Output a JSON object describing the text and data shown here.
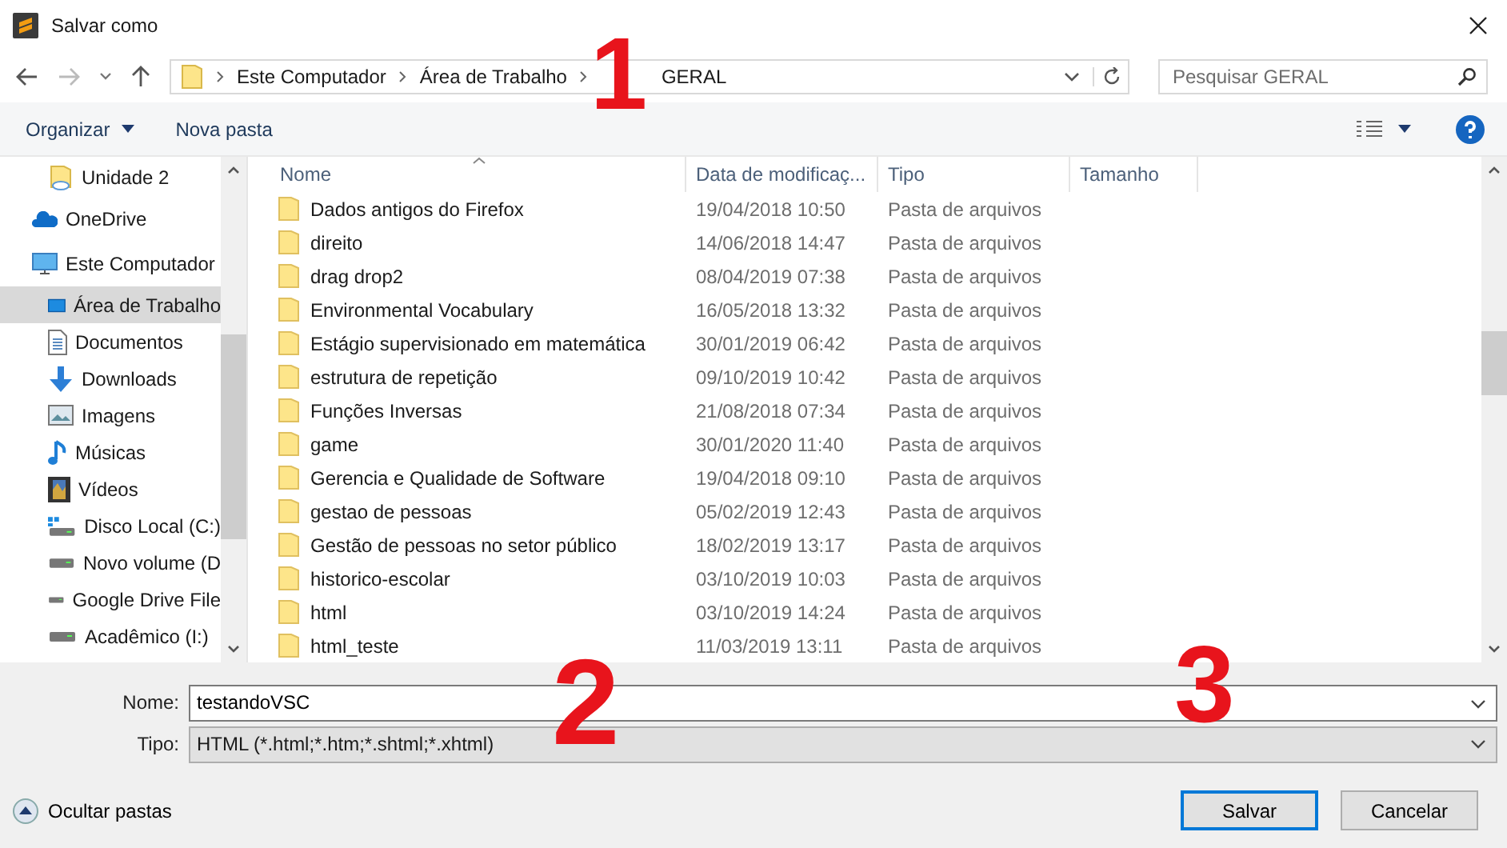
{
  "window": {
    "title": "Salvar como"
  },
  "address_bar": {
    "crumbs": [
      "Este Computador",
      "Área de Trabalho",
      "GERAL"
    ]
  },
  "search": {
    "placeholder": "Pesquisar GERAL"
  },
  "toolbar": {
    "organize": "Organizar",
    "new_folder": "Nova pasta"
  },
  "sidebar": {
    "items": [
      {
        "children": [
          {
            "label": "Unidade 2",
            "kind": "cloud-folder",
            "selected": false
          }
        ]
      },
      {
        "label": "OneDrive",
        "kind": "cloud",
        "selected": false
      },
      {
        "label": "Este Computador",
        "kind": "computer",
        "selected": false,
        "children": [
          {
            "label": "Área de Trabalho",
            "kind": "desktop",
            "selected": true
          },
          {
            "label": "Documentos",
            "kind": "document",
            "selected": false
          },
          {
            "label": "Downloads",
            "kind": "download",
            "selected": false
          },
          {
            "label": "Imagens",
            "kind": "image",
            "selected": false
          },
          {
            "label": "Músicas",
            "kind": "music",
            "selected": false
          },
          {
            "label": "Vídeos",
            "kind": "video",
            "selected": false
          },
          {
            "label": "Disco Local (C:)",
            "kind": "system-drive",
            "selected": false
          },
          {
            "label": "Novo volume (D",
            "kind": "drive",
            "selected": false
          },
          {
            "label": "Google Drive File",
            "kind": "drive",
            "selected": false
          },
          {
            "label": "Acadêmico (I:)",
            "kind": "drive",
            "selected": false
          }
        ]
      }
    ]
  },
  "table": {
    "columns": [
      "Nome",
      "Data de modificaç...",
      "Tipo",
      "Tamanho"
    ],
    "rows": [
      {
        "name": "Dados antigos do Firefox",
        "date": "19/04/2018 10:50",
        "type": "Pasta de arquivos"
      },
      {
        "name": "direito",
        "date": "14/06/2018 14:47",
        "type": "Pasta de arquivos"
      },
      {
        "name": "drag drop2",
        "date": "08/04/2019 07:38",
        "type": "Pasta de arquivos"
      },
      {
        "name": "Environmental Vocabulary",
        "date": "16/05/2018 13:32",
        "type": "Pasta de arquivos"
      },
      {
        "name": "Estágio supervisionado em matemática",
        "date": "30/01/2019 06:42",
        "type": "Pasta de arquivos"
      },
      {
        "name": "estrutura de repetição",
        "date": "09/10/2019 10:42",
        "type": "Pasta de arquivos"
      },
      {
        "name": "Funções Inversas",
        "date": "21/08/2018 07:34",
        "type": "Pasta de arquivos"
      },
      {
        "name": "game",
        "date": "30/01/2020 11:40",
        "type": "Pasta de arquivos"
      },
      {
        "name": "Gerencia e Qualidade de Software",
        "date": "19/04/2018 09:10",
        "type": "Pasta de arquivos"
      },
      {
        "name": "gestao de pessoas",
        "date": "05/02/2019 12:43",
        "type": "Pasta de arquivos"
      },
      {
        "name": "Gestão de pessoas no setor público",
        "date": "18/02/2019 13:17",
        "type": "Pasta de arquivos"
      },
      {
        "name": "historico-escolar",
        "date": "03/10/2019 10:03",
        "type": "Pasta de arquivos"
      },
      {
        "name": "html",
        "date": "03/10/2019 14:24",
        "type": "Pasta de arquivos"
      },
      {
        "name": "html_teste",
        "date": "11/03/2019 13:11",
        "type": "Pasta de arquivos"
      }
    ]
  },
  "form": {
    "name_label": "Nome:",
    "name_value": "testandoVSC",
    "type_label": "Tipo:",
    "type_value": "HTML (*.html;*.htm;*.shtml;*.xhtml)"
  },
  "footer": {
    "hide_folders": "Ocultar pastas",
    "buttons": [
      "Salvar",
      "Cancelar"
    ]
  },
  "annotations": [
    {
      "label": "1",
      "kind": "top"
    },
    {
      "label": "2",
      "kind": "left"
    },
    {
      "label": "3",
      "kind": "right"
    }
  ]
}
